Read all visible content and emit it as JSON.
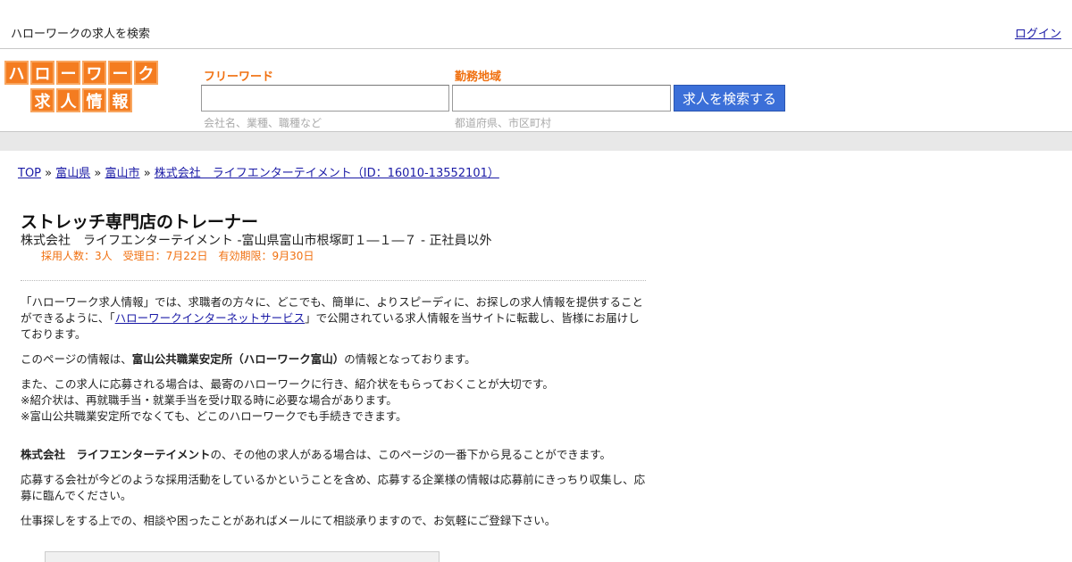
{
  "header": {
    "tagline": "ハローワークの求人を検索",
    "login": "ログイン"
  },
  "logo": {
    "row1": [
      "ハ",
      "ロ",
      "ー",
      "ワ",
      "ー",
      "ク"
    ],
    "row2": [
      "求",
      "人",
      "情",
      "報"
    ]
  },
  "search": {
    "keyword_label": "フリーワード",
    "keyword_value": "",
    "keyword_hint": "会社名、業種、職種など",
    "location_label": "勤務地域",
    "location_value": "",
    "location_hint": "都道府県、市区町村",
    "button": "求人を検索する"
  },
  "breadcrumb": {
    "items": [
      "TOP",
      "富山県",
      "富山市",
      "株式会社　ライフエンターテイメント（ID：16010-13552101）"
    ],
    "separator": "»"
  },
  "job": {
    "title": "ストレッチ専門店のトレーナー",
    "subtitle": "株式会社　ライフエンターテイメント -富山県富山市根塚町１―１―７ - 正社員以外",
    "meta": "採用人数：3人　受理日：7月22日　有効期限：9月30日"
  },
  "body": {
    "p1_before": "「ハローワーク求人情報」では、求職者の方々に、どこでも、簡単に、よりスピーディに、お探しの求人情報を提供することができるように、「",
    "p1_link": "ハローワークインターネットサービス",
    "p1_after": "」で公開されている求人情報を当サイトに転載し、皆様にお届けしております。",
    "p2_before": "このページの情報は、",
    "p2_bold": "富山公共職業安定所（ハローワーク富山）",
    "p2_after": "の情報となっております。",
    "p3_line1": "また、この求人に応募される場合は、最寄のハローワークに行き、紹介状をもらっておくことが大切です。",
    "p3_line2": "※紹介状は、再就職手当・就業手当を受け取る時に必要な場合があります。",
    "p3_line3": "※富山公共職業安定所でなくても、どこのハローワークでも手続きできます。",
    "p4_bold": "株式会社　ライフエンターテイメント",
    "p4_after": "の、その他の求人がある場合は、このページの一番下から見ることができます。",
    "p5": "応募する会社が今どのような採用活動をしているかということを含め、応募する企業様の情報は応募前にきっちり収集し、応募に臨んでください。",
    "p6": "仕事探しをする上での、相談や困ったことがあればメールにて相談承りますので、お気軽にご登録下さい。"
  },
  "colors": {
    "accent": "#f07010",
    "logo_tile": "#f47c20",
    "button": "#3b6fd8",
    "link": "#1a1aa6"
  }
}
